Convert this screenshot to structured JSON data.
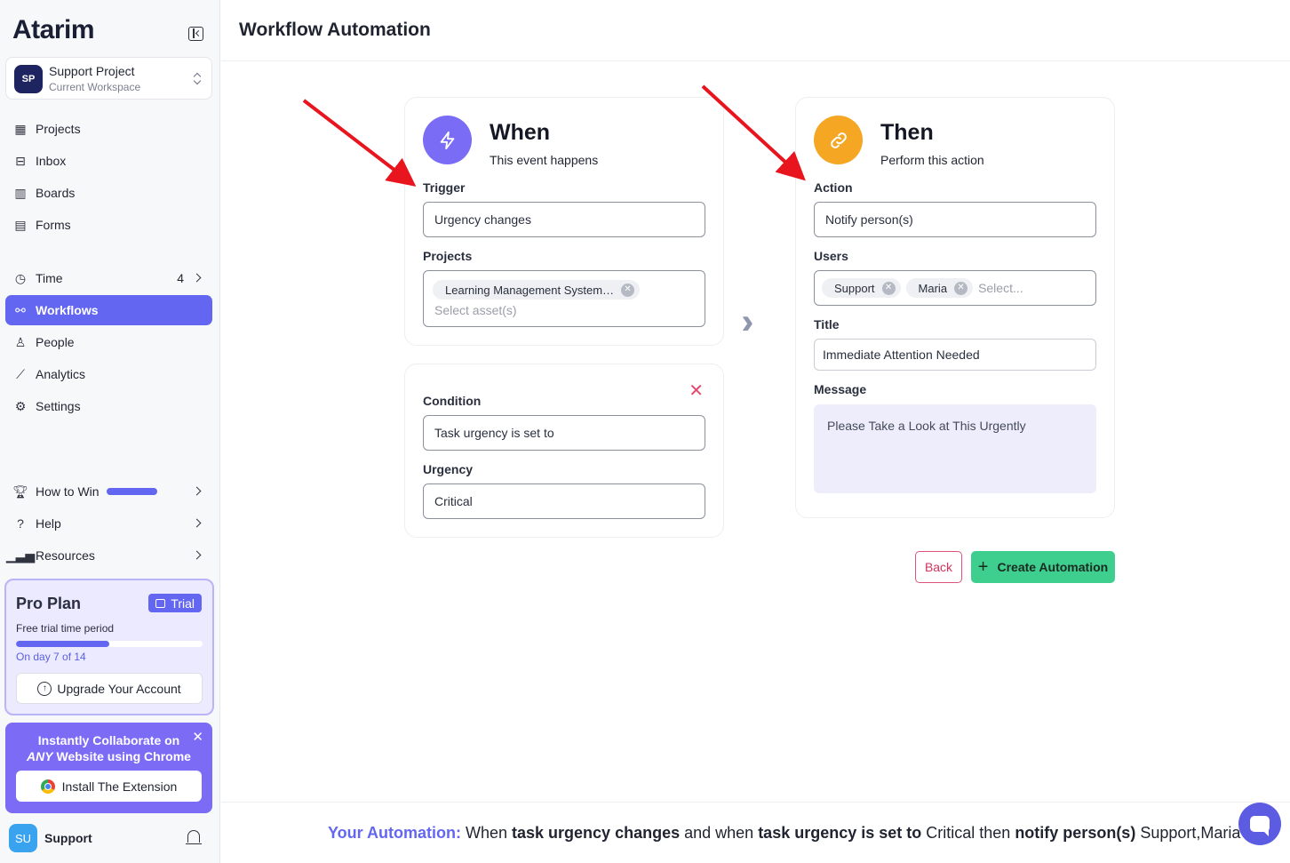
{
  "brand": {
    "name": "Atarim"
  },
  "workspace": {
    "initials": "SP",
    "name": "Support Project",
    "subtitle": "Current Workspace"
  },
  "nav": {
    "projects": "Projects",
    "inbox": "Inbox",
    "boards": "Boards",
    "forms": "Forms",
    "time": "Time",
    "time_count": "4",
    "workflows": "Workflows",
    "people": "People",
    "analytics": "Analytics",
    "settings": "Settings",
    "how_to_win": "How to Win",
    "help": "Help",
    "resources": "Resources"
  },
  "plan": {
    "title": "Pro Plan",
    "badge": "Trial",
    "subtitle": "Free trial time period",
    "progress": 0.5,
    "day_text": "On day 7 of 14",
    "upgrade_label": "Upgrade Your Account"
  },
  "extension": {
    "line1": "Instantly Collaborate on",
    "line2_em": "ANY",
    "line2_rest": " Website using Chrome",
    "button": "Install The Extension"
  },
  "user": {
    "initials": "SU",
    "name": "Support"
  },
  "page": {
    "title": "Workflow Automation"
  },
  "when": {
    "title": "When",
    "subtitle": "This event happens",
    "trigger_label": "Trigger",
    "trigger_value": "Urgency changes",
    "projects_label": "Projects",
    "project_chip": "Learning Management System…",
    "projects_placeholder": "Select asset(s)"
  },
  "condition": {
    "label": "Condition",
    "value": "Task urgency is set to",
    "urgency_label": "Urgency",
    "urgency_value": "Critical"
  },
  "then": {
    "title": "Then",
    "subtitle": "Perform this action",
    "action_label": "Action",
    "action_value": "Notify person(s)",
    "users_label": "Users",
    "users": [
      "Support",
      "Maria"
    ],
    "users_placeholder": "Select...",
    "title_label": "Title",
    "title_value": "Immediate Attention Needed",
    "message_label": "Message",
    "message_value": "Please Take a Look at This Urgently"
  },
  "buttons": {
    "back": "Back",
    "create": "Create Automation"
  },
  "summary": {
    "lead": "Your Automation:",
    "t1": " When ",
    "b1": "task urgency changes",
    "t2": " and when ",
    "b2": "task urgency is set to",
    "t3": " Critical then ",
    "b3": "notify person(s)",
    "t4": " Support,Maria"
  },
  "colors": {
    "accent": "#6366f1",
    "success": "#3ecf8e",
    "then_icon": "#f5a623",
    "annotation": "#e8141e"
  }
}
